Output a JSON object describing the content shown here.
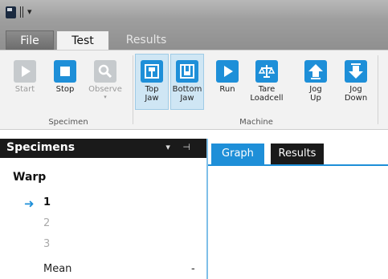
{
  "ribbon_tabs": {
    "file": "File",
    "test": "Test",
    "results": "Results"
  },
  "groups": {
    "specimen": {
      "label": "Specimen",
      "buttons": [
        {
          "label": "Start",
          "icon": "play-icon",
          "enabled": false
        },
        {
          "label": "Stop",
          "icon": "stop-icon",
          "enabled": true
        },
        {
          "label": "Observe",
          "icon": "magnifier-icon",
          "enabled": false
        }
      ]
    },
    "machine": {
      "label": "Machine",
      "buttons": [
        {
          "label_line1": "Top",
          "label_line2": "Jaw",
          "icon": "top-jaw-icon",
          "active": true
        },
        {
          "label_line1": "Bottom",
          "label_line2": "Jaw",
          "icon": "bottom-jaw-icon",
          "active": true
        },
        {
          "label_line1": "Run",
          "label_line2": "",
          "icon": "run-icon"
        },
        {
          "label_line1": "Tare",
          "label_line2": "Loadcell",
          "icon": "scale-icon"
        },
        {
          "label_line1": "Jog",
          "label_line2": "Up",
          "icon": "arrow-up-icon"
        },
        {
          "label_line1": "Jog",
          "label_line2": "Down",
          "icon": "arrow-down-icon"
        }
      ]
    }
  },
  "specimens": {
    "title": "Specimens",
    "controls": "▾ ⊣",
    "group_name": "Warp",
    "items": [
      "1",
      "2",
      "3"
    ],
    "selected_index": 0,
    "mean_label": "Mean",
    "mean_value": "-"
  },
  "doc_tabs": {
    "graph": "Graph",
    "results": "Results"
  },
  "colors": {
    "accent": "#1e8fd8",
    "dark": "#1a1a1a",
    "ribbon": "#f2f2f2"
  }
}
